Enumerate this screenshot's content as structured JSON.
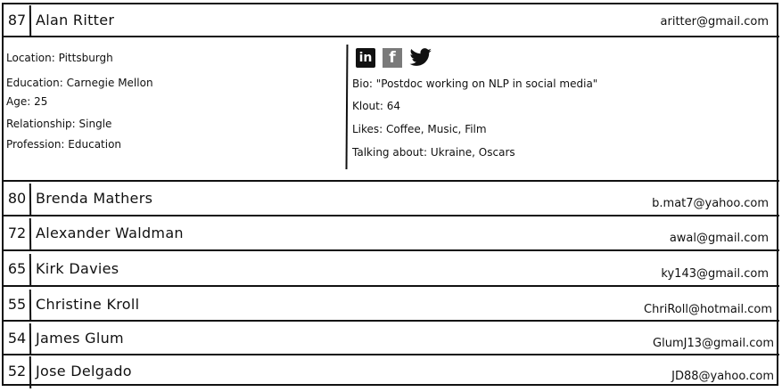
{
  "expanded": {
    "score": "87",
    "name": "Alan Ritter",
    "email": "aritter@gmail.com",
    "details_left": [
      "Location: Pittsburgh",
      "Education: Carnegie Mellon",
      "Age: 25",
      "Relationship: Single",
      "Profession: Education"
    ],
    "details_right": {
      "bio": "Bio: \"Postdoc working on NLP in social media\"",
      "klout": "Klout: 64",
      "likes": "Likes: Coffee, Music, Film",
      "talking": "Talking about: Ukraine, Oscars"
    },
    "social_icons": [
      "linkedin-icon",
      "facebook-icon",
      "twitter-icon"
    ],
    "social_labels": {
      "linkedin": "in",
      "facebook": "f"
    }
  },
  "rows": [
    {
      "score": "80",
      "name": "Brenda Mathers",
      "email": "b.mat7@yahoo.com"
    },
    {
      "score": "72",
      "name": "Alexander Waldman",
      "email": "awal@gmail.com"
    },
    {
      "score": "65",
      "name": "Kirk Davies",
      "email": "ky143@gmail.com"
    },
    {
      "score": "55",
      "name": "Christine Kroll",
      "email": "ChriRoll@hotmail.com"
    },
    {
      "score": "54",
      "name": "James Glum",
      "email": "GlumJ13@gmail.com"
    },
    {
      "score": "52",
      "name": "Jose Delgado",
      "email": "JD88@yahoo.com"
    }
  ]
}
